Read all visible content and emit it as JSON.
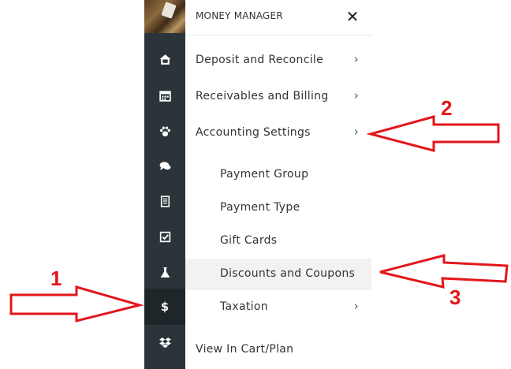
{
  "header": {
    "title": "MONEY MANAGER",
    "close_symbol": "✕"
  },
  "rail": {
    "items": [
      {
        "icon": "home-icon"
      },
      {
        "icon": "calendar-icon"
      },
      {
        "icon": "paw-icon"
      },
      {
        "icon": "chat-icon"
      },
      {
        "icon": "receipt-icon"
      },
      {
        "icon": "checkbox-icon"
      },
      {
        "icon": "flask-icon"
      },
      {
        "icon": "dollar-icon",
        "symbol": "$",
        "active": true
      },
      {
        "icon": "dropbox-icon"
      }
    ]
  },
  "menu": {
    "items": [
      {
        "label": "Deposit and Reconcile",
        "chevron": "›"
      },
      {
        "label": "Receivables and Billing",
        "chevron": "›"
      },
      {
        "label": "Accounting Settings",
        "chevron": "›"
      },
      {
        "label": "Payment Group"
      },
      {
        "label": "Payment Type"
      },
      {
        "label": "Gift Cards"
      },
      {
        "label": "Discounts and Coupons",
        "highlighted": true
      },
      {
        "label": "Taxation",
        "chevron": "›"
      },
      {
        "label": "View In Cart/Plan"
      }
    ]
  },
  "annotations": {
    "labels": [
      "1",
      "2",
      "3"
    ],
    "color": "#e3161b"
  },
  "colors": {
    "rail_bg": "#2b3438",
    "highlight_bg": "#f2f2f2",
    "annotation": "#e3161b"
  }
}
